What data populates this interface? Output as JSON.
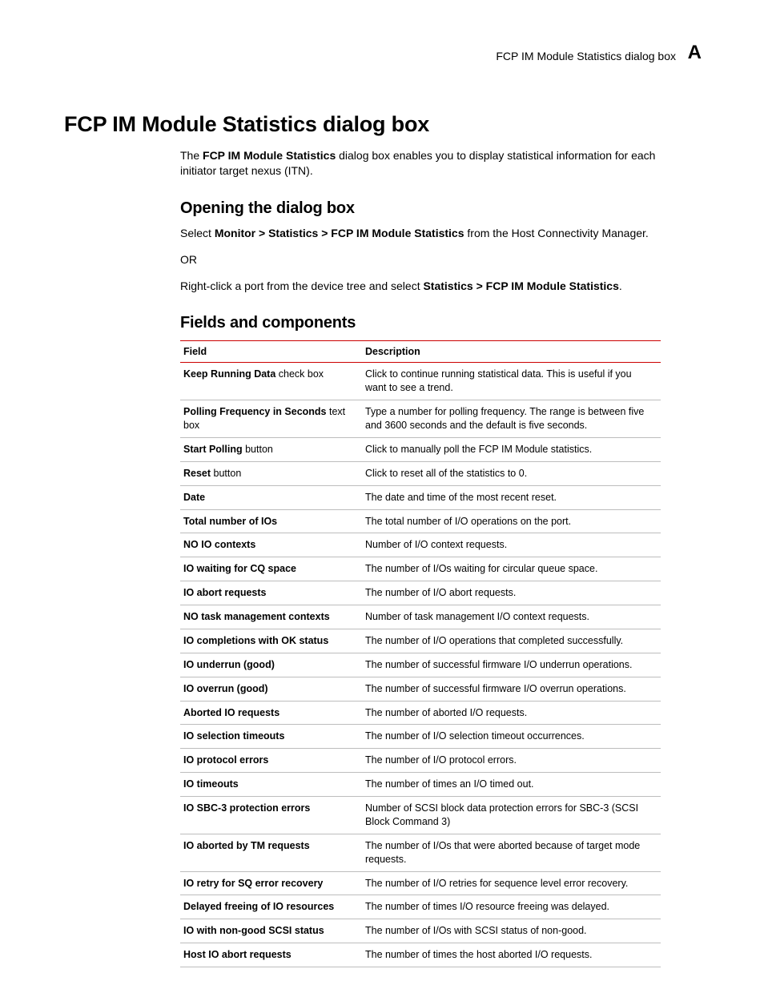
{
  "header": {
    "running": "FCP IM Module Statistics dialog box",
    "appendix": "A"
  },
  "title": "FCP IM Module Statistics dialog box",
  "intro": {
    "pre": "The ",
    "bold": "FCP IM Module Statistics",
    "post": " dialog box enables you to display statistical information for each initiator target nexus (ITN)."
  },
  "opening": {
    "heading": "Opening the dialog box",
    "p1_pre": "Select ",
    "p1_bold": "Monitor > Statistics > FCP IM Module Statistics",
    "p1_post": " from the Host Connectivity Manager.",
    "or": "OR",
    "p2_pre": "Right-click a port from the device tree and select ",
    "p2_bold": "Statistics > FCP IM Module Statistics",
    "p2_post": "."
  },
  "fields": {
    "heading": "Fields and components",
    "col1": "Field",
    "col2": "Description",
    "rows": [
      {
        "field_bold": "Keep Running Data",
        "field_rest": " check box",
        "desc": "Click to continue running statistical data. This is useful if you want to see a trend."
      },
      {
        "field_bold": "Polling Frequency in Seconds",
        "field_rest": " text box",
        "desc": "Type a number for polling frequency. The range is between five and 3600 seconds and the default is five seconds."
      },
      {
        "field_bold": "Start Polling",
        "field_rest": " button",
        "desc": "Click to manually poll the FCP IM Module statistics."
      },
      {
        "field_bold": "Reset",
        "field_rest": " button",
        "desc": "Click to reset all of the statistics to 0."
      },
      {
        "field_bold": "Date",
        "field_rest": "",
        "desc": "The date and time of the most recent reset."
      },
      {
        "field_bold": "Total number of IOs",
        "field_rest": "",
        "desc": "The total number of I/O operations on the port."
      },
      {
        "field_bold": "NO IO contexts",
        "field_rest": "",
        "desc": "Number of I/O context requests."
      },
      {
        "field_bold": "IO waiting for CQ space",
        "field_rest": "",
        "desc": "The number of I/Os waiting for circular queue space."
      },
      {
        "field_bold": "IO abort requests",
        "field_rest": "",
        "desc": "The number of I/O abort requests."
      },
      {
        "field_bold": "NO task management contexts",
        "field_rest": "",
        "desc": "Number of task management I/O context requests."
      },
      {
        "field_bold": "IO completions with OK status",
        "field_rest": "",
        "desc": "The number of I/O operations that completed successfully."
      },
      {
        "field_bold": "IO underrun (good)",
        "field_rest": "",
        "desc": "The number of successful firmware I/O underrun operations."
      },
      {
        "field_bold": "IO overrun (good)",
        "field_rest": "",
        "desc": "The number of successful firmware I/O overrun operations."
      },
      {
        "field_bold": "Aborted IO requests",
        "field_rest": "",
        "desc": "The number of aborted I/O requests."
      },
      {
        "field_bold": "IO selection timeouts",
        "field_rest": "",
        "desc": "The number of I/O selection timeout occurrences."
      },
      {
        "field_bold": "IO protocol errors",
        "field_rest": "",
        "desc": "The number of I/O protocol errors."
      },
      {
        "field_bold": "IO timeouts",
        "field_rest": "",
        "desc": "The number of times an I/O timed out."
      },
      {
        "field_bold": "IO SBC-3 protection errors",
        "field_rest": "",
        "desc": "Number of SCSI block data protection errors for SBC-3 (SCSI Block Command 3)"
      },
      {
        "field_bold": "IO aborted by TM requests",
        "field_rest": "",
        "desc": "The number of I/Os that were aborted because of target mode requests."
      },
      {
        "field_bold": "IO retry for SQ error recovery",
        "field_rest": "",
        "desc": "The number of I/O retries for sequence level error recovery."
      },
      {
        "field_bold": "Delayed freeing of IO resources",
        "field_rest": "",
        "desc": "The number of times I/O resource freeing was delayed."
      },
      {
        "field_bold": "IO with non-good SCSI status",
        "field_rest": "",
        "desc": "The number of I/Os with SCSI status of non-good."
      },
      {
        "field_bold": "Host IO abort requests",
        "field_rest": "",
        "desc": "The number of times the host aborted I/O requests."
      }
    ]
  }
}
